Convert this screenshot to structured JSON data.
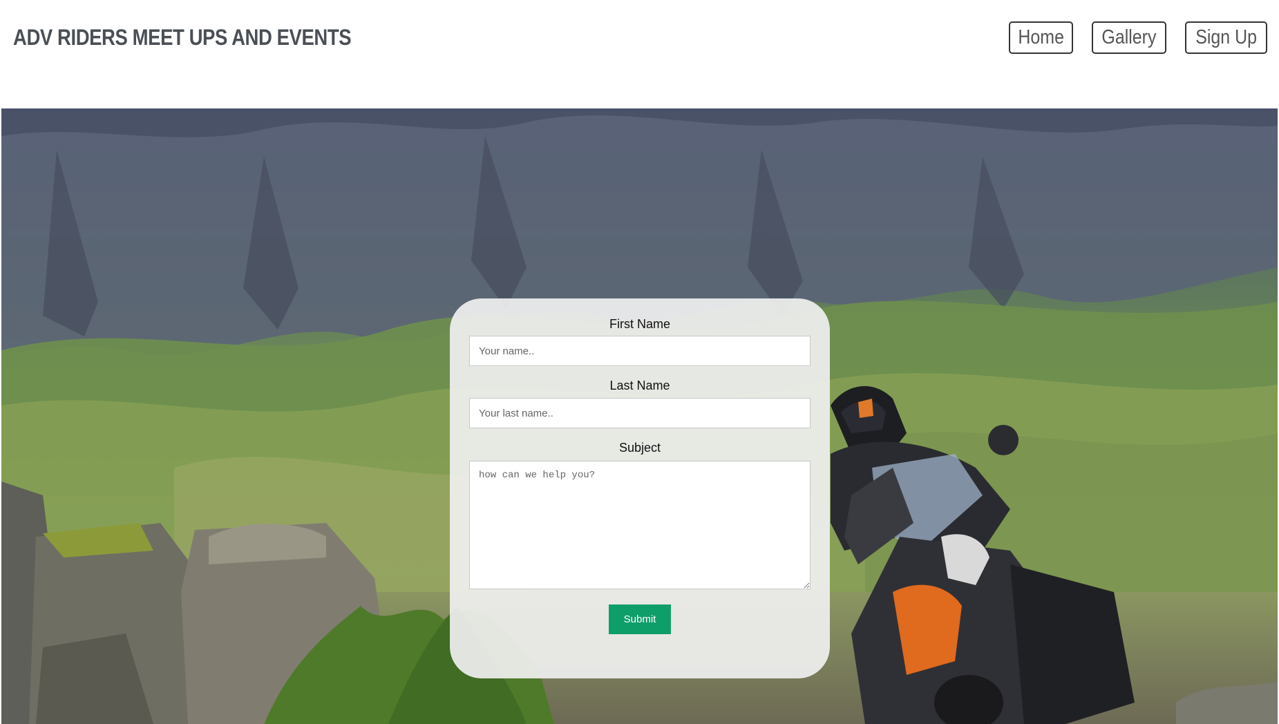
{
  "header": {
    "site_title": "ADV RIDERS MEET UPS AND EVENTS",
    "nav": [
      {
        "label": "Home"
      },
      {
        "label": "Gallery"
      },
      {
        "label": "Sign Up"
      }
    ]
  },
  "contact_form": {
    "first_name": {
      "label": "First Name",
      "placeholder": "Your name.."
    },
    "last_name": {
      "label": "Last Name",
      "placeholder": "Your last name.."
    },
    "subject": {
      "label": "Subject",
      "placeholder": "how can we help you?"
    },
    "submit_label": "Submit"
  },
  "colors": {
    "title_text": "#4a4f55",
    "submit_button": "#0e9e6a",
    "form_card": "#f0f0f0"
  }
}
